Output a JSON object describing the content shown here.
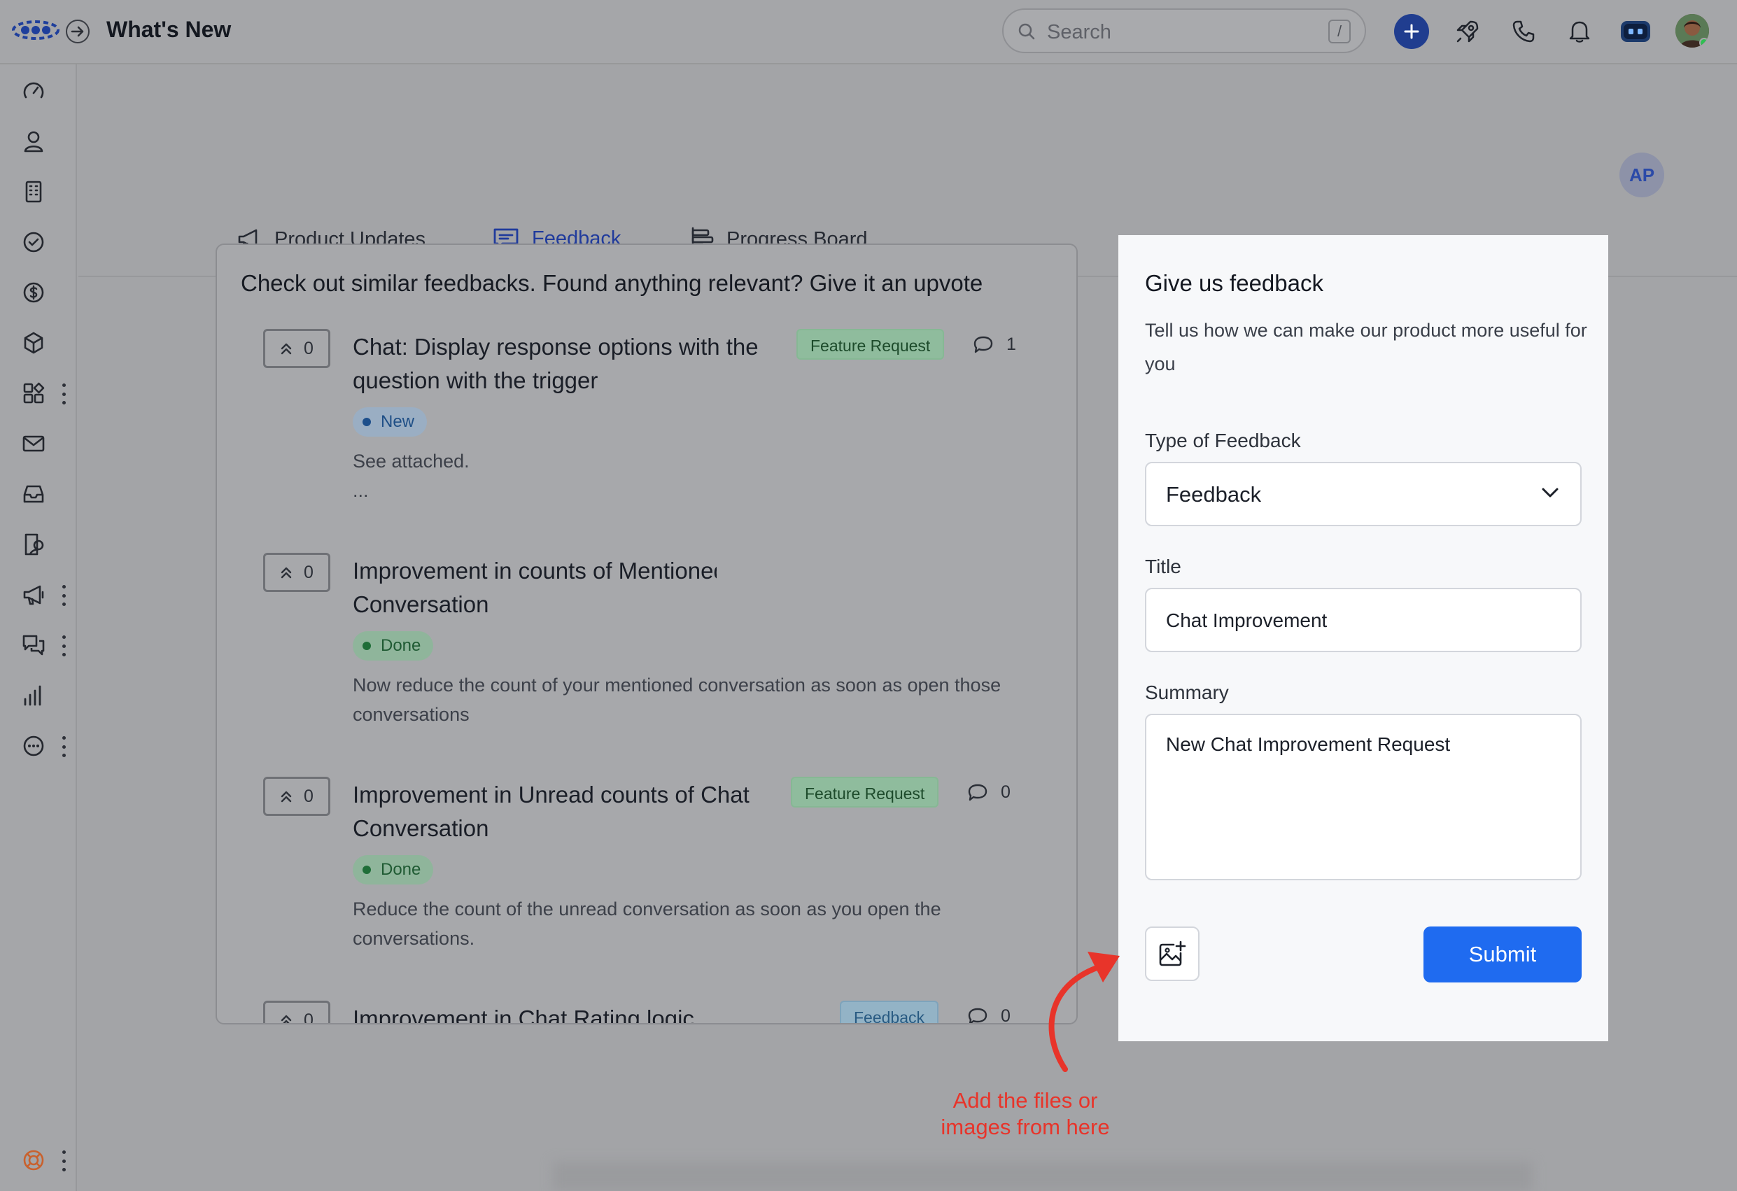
{
  "header": {
    "title": "What's New",
    "search_placeholder": "Search",
    "search_shortcut": "/"
  },
  "colors": {
    "accent": "#1f6bf0",
    "active_tab": "#203b9c",
    "annotation": "#e8342a",
    "status_done": "#1f6e38",
    "status_new": "#1d4f8b"
  },
  "user": {
    "initials": "AP"
  },
  "tabs": [
    {
      "label": "Product Updates",
      "icon": "megaphone-icon",
      "active": false
    },
    {
      "label": "Feedback",
      "icon": "chat-bubble-icon",
      "active": true
    },
    {
      "label": "Progress Board",
      "icon": "kanban-icon",
      "active": false
    }
  ],
  "similar": {
    "heading": "Check out similar feedbacks. Found anything relevant? Give it an upvote",
    "items": [
      {
        "votes": "0",
        "title_line1": "Chat: Display response options with the",
        "title_line2": "question with the trigger",
        "tag": "Feature Request",
        "comments": "1",
        "status": "New",
        "desc_line1": "See attached.",
        "desc_line2": "..."
      },
      {
        "votes": "0",
        "title_line1": "Improvement in counts of Mentioned",
        "title_line2": "Conversation",
        "status": "Done",
        "desc_line1": "Now reduce the count of your mentioned conversation as soon as open those",
        "desc_line2": "conversations"
      },
      {
        "votes": "0",
        "title_line1": "Improvement in Unread counts of Chat",
        "title_line2": "Conversation",
        "tag": "Feature Request",
        "comments": "0",
        "status": "Done",
        "desc_line1": "Reduce the count of the unread conversation as soon as you open the",
        "desc_line2": "conversations."
      },
      {
        "votes": "0",
        "title_line1": "Improvement in Chat Rating logic",
        "tag": "Feedback",
        "comments": "0"
      }
    ]
  },
  "form": {
    "title": "Give us feedback",
    "subtitle": "Tell us how we can make our product more useful for you",
    "type_label": "Type of Feedback",
    "type_value": "Feedback",
    "title_label": "Title",
    "title_value": "Chat Improvement",
    "summary_label": "Summary",
    "summary_value": "New Chat Improvement Request",
    "submit_label": "Submit"
  },
  "annotation": {
    "line1": "Add the files or",
    "line2": "images from here"
  }
}
